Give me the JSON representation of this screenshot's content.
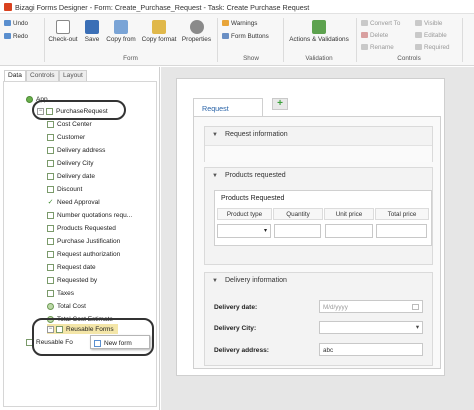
{
  "window": {
    "title": "Bizagi Forms Designer - Form: Create_Purchase_Request - Task: Create Purchase Request"
  },
  "ribbon": {
    "undo": "Undo",
    "redo": "Redo",
    "buttons": [
      "Check-out",
      "Save",
      "Copy from",
      "Copy format",
      "Properties"
    ],
    "form_group": "Form",
    "warnings": "Warnings",
    "form_buttons": "Form Buttons",
    "show_group": "Show",
    "actions_validations": "Actions & Validations",
    "validation_group": "Validation",
    "convert_to": "Convert To",
    "delete": "Delete",
    "rename": "Rename",
    "visible": "Visible",
    "editable": "Editable",
    "required": "Required",
    "controls_group": "Controls",
    "colors": {
      "accent": "#2a64a8",
      "logo": "#d9411e"
    }
  },
  "left": {
    "tabs": [
      "Data",
      "Controls",
      "Layout"
    ],
    "tree": {
      "app": "App",
      "purchase_request": "PurchaseRequest",
      "items": [
        "Cost Center",
        "Customer",
        "Delivery address",
        "Delivery City",
        "Delivery date",
        "Discount",
        "Need Approval",
        "Number quotations requ...",
        "Products Requested",
        "Purchase Justification",
        "Request authorization",
        "Request date",
        "Requested by",
        "Taxes",
        "Total Cost",
        "Total Cost Estimate"
      ],
      "reusable_forms": "Reusable Forms",
      "reusable_forms_partial": "Reusable Fo",
      "context_menu_item": "New form"
    }
  },
  "form": {
    "tab_label": "Request",
    "add_tab": "+",
    "sections": {
      "request_info": "Request information",
      "products_requested": "Products requested",
      "delivery_info": "Delivery information"
    },
    "products_table": {
      "title": "Products Requested",
      "columns": [
        "Product type",
        "Quantity",
        "Unit price",
        "Total price"
      ]
    },
    "delivery": {
      "date_label": "Delivery date:",
      "date_placeholder": "M/d/yyyy",
      "city_label": "Delivery City:",
      "address_label": "Delivery address:",
      "address_value": "abc"
    }
  }
}
